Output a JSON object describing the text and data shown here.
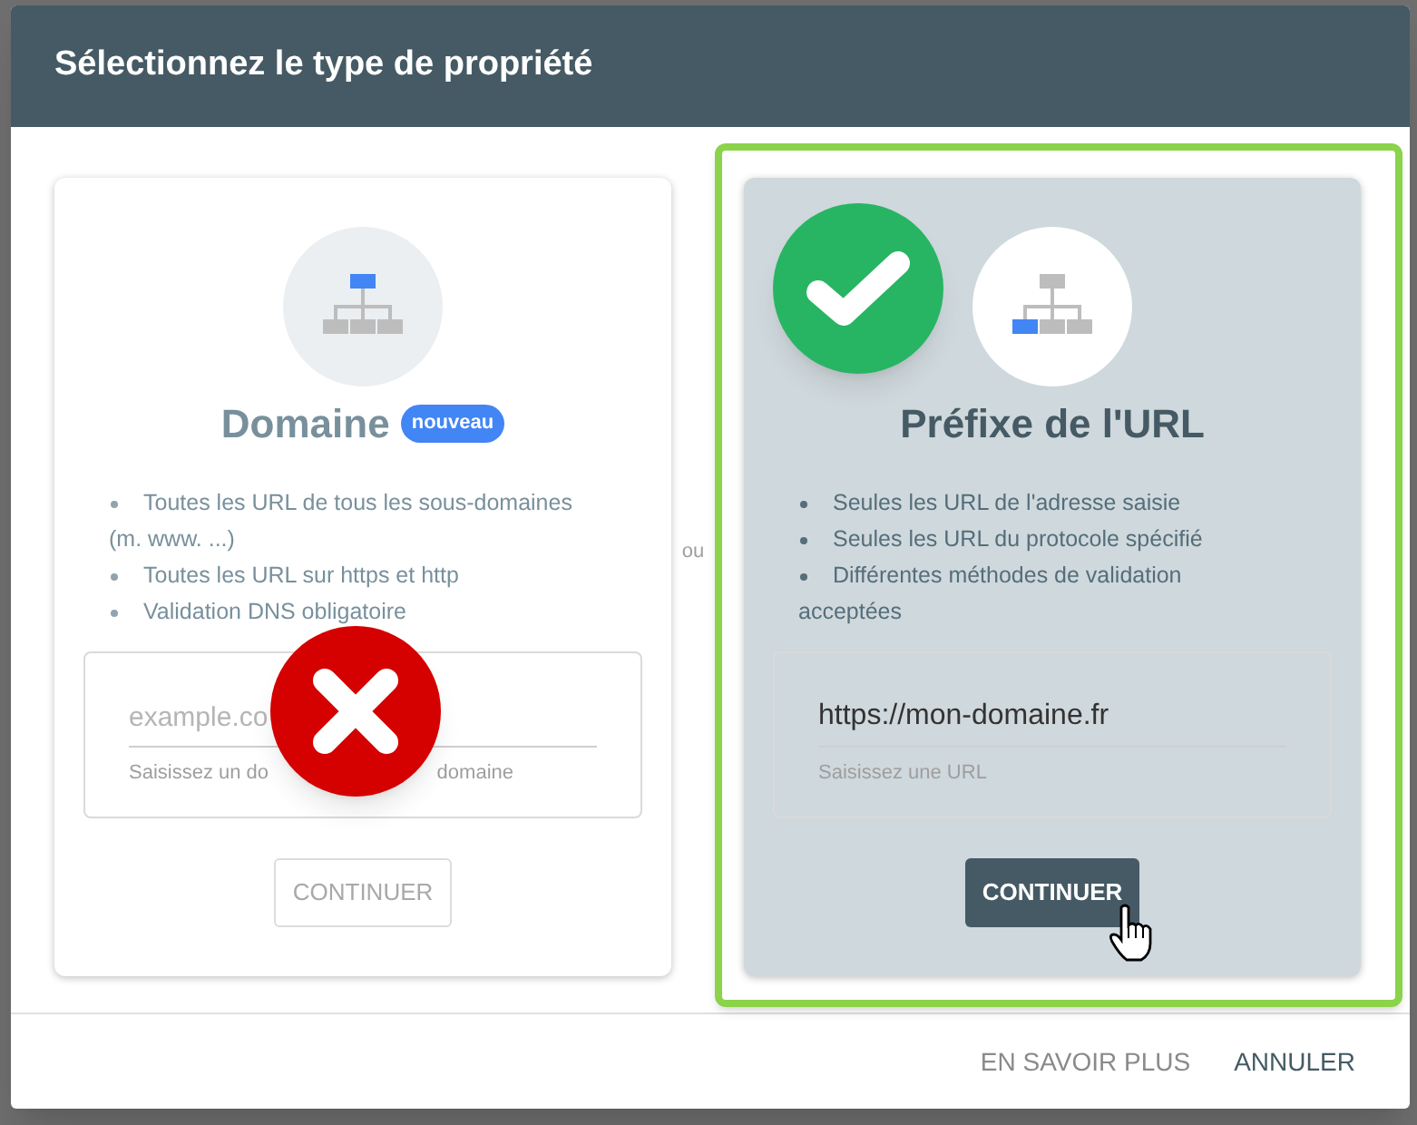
{
  "dialog": {
    "title": "Sélectionnez le type de propriété"
  },
  "options": [
    {
      "kind": "domain",
      "selected": false,
      "correct": false,
      "title": "Domaine",
      "badge": "nouveau",
      "bullets": [
        "Toutes les URL de tous les sous-domaines (m. www. ...)",
        "Toutes les URL sur https et http",
        "Validation DNS obligatoire"
      ],
      "field": {
        "placeholder": "example.co",
        "helper": [
          "Saisissez un do",
          "domaine"
        ]
      },
      "button": {
        "label": "CONTINUER",
        "disabled": true
      }
    },
    {
      "kind": "url_prefix",
      "selected": true,
      "correct": true,
      "title": "Préfixe de l'URL",
      "bullets": [
        "Seules les URL de l'adresse saisie",
        "Seules les URL du protocole spécifié",
        "Différentes méthodes de validation acceptées"
      ],
      "field": {
        "value": "https://mon-domaine.fr",
        "helper": [
          "Saisissez une URL"
        ]
      },
      "button": {
        "label": "CONTINUER",
        "disabled": false
      }
    }
  ],
  "separator": "ou",
  "footer": {
    "buttons": [
      {
        "label": "EN SAVOIR PLUS",
        "primary": false
      },
      {
        "label": "ANNULER",
        "primary": true
      }
    ]
  }
}
